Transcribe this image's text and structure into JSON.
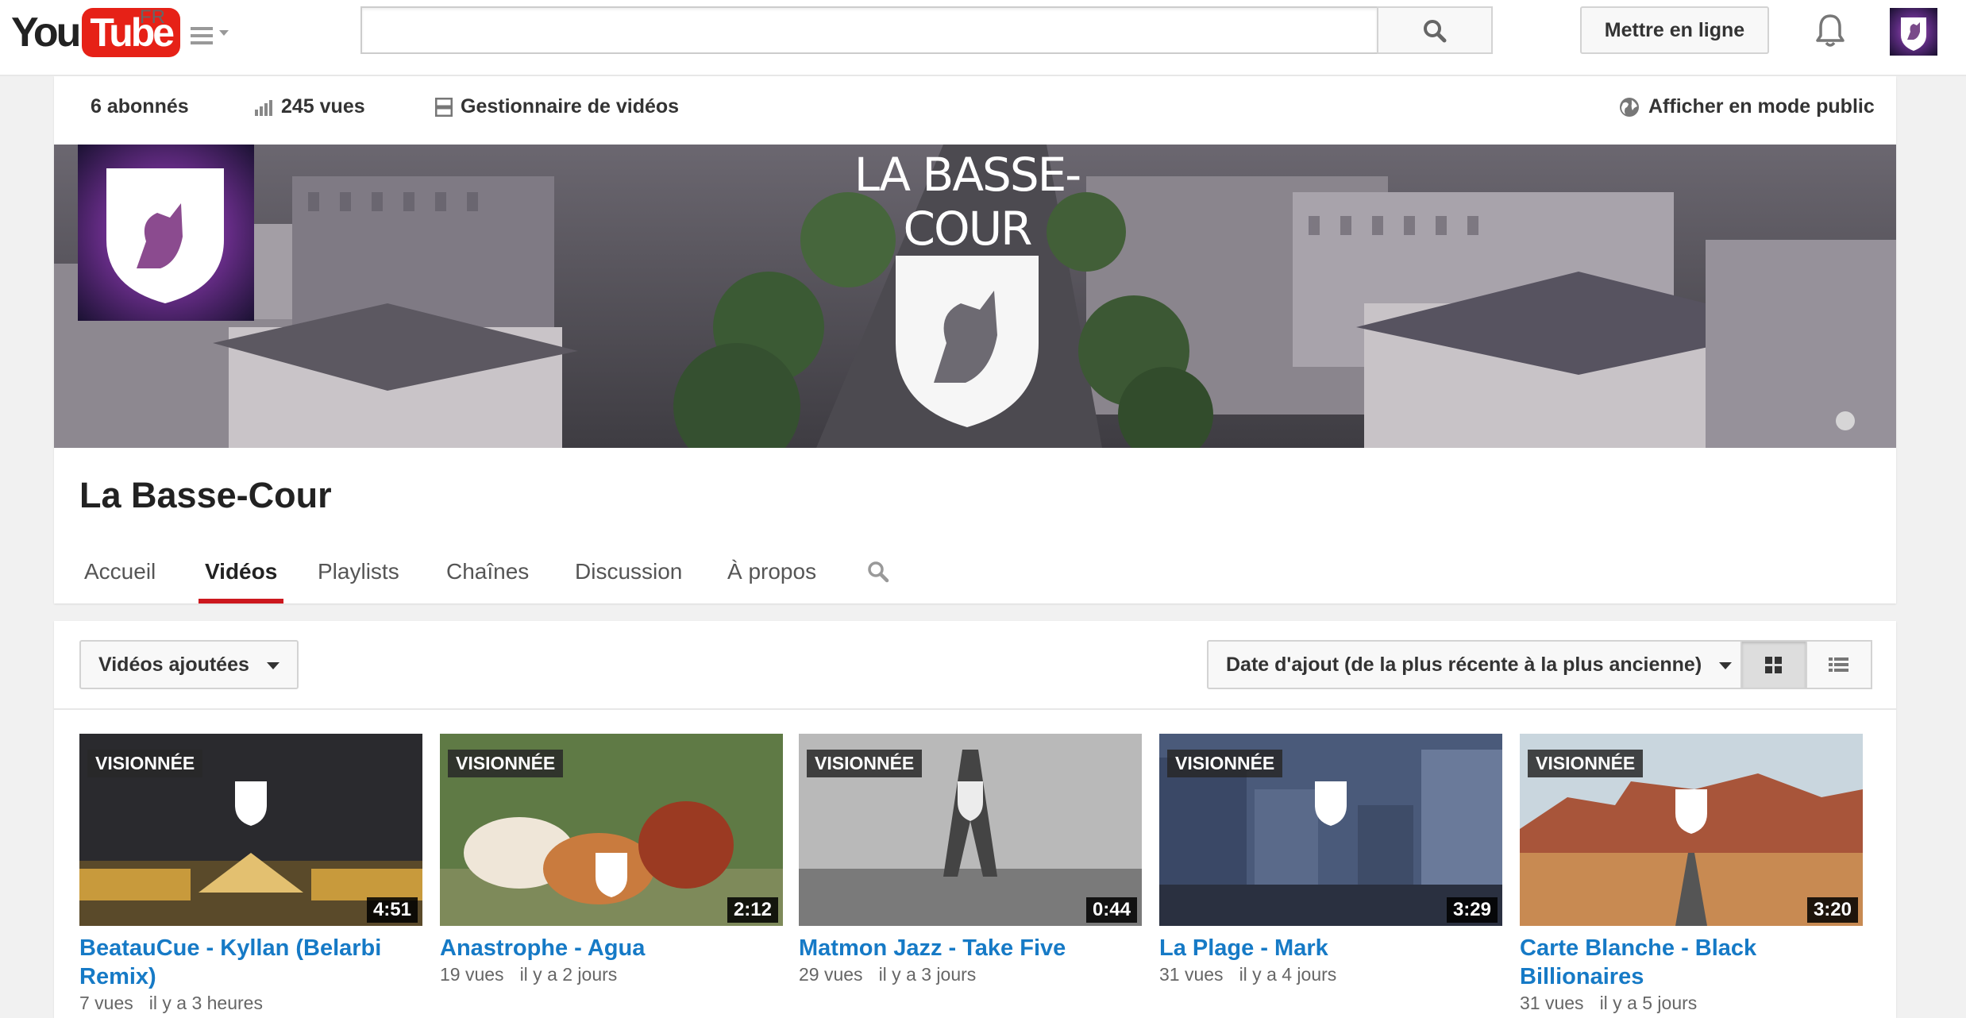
{
  "masthead": {
    "logo_you": "You",
    "logo_tube": "Tube",
    "region": "FR",
    "search_placeholder": "",
    "upload_label": "Mettre en ligne"
  },
  "stats": {
    "subscribers": "6 abonnés",
    "views": "245 vues",
    "video_manager": "Gestionnaire de vidéos",
    "public_view": "Afficher en mode public"
  },
  "banner": {
    "wordmark": "LA BASSE-COUR"
  },
  "channel": {
    "title": "La Basse-Cour"
  },
  "tabs": [
    {
      "label": "Accueil"
    },
    {
      "label": "Vidéos"
    },
    {
      "label": "Playlists"
    },
    {
      "label": "Chaînes"
    },
    {
      "label": "Discussion"
    },
    {
      "label": "À propos"
    }
  ],
  "filters": {
    "content_filter": "Vidéos ajoutées",
    "sort_filter": "Date d'ajout (de la plus récente à la plus ancienne)"
  },
  "videos": [
    {
      "watched": "VISIONNÉE",
      "duration": "4:51",
      "title": "BeatauCue - Kyllan (Belarbi Remix)",
      "views": "7 vues",
      "age": "il y a 3 heures"
    },
    {
      "watched": "VISIONNÉE",
      "duration": "2:12",
      "title": "Anastrophe - Agua",
      "views": "19 vues",
      "age": "il y a 2 jours"
    },
    {
      "watched": "VISIONNÉE",
      "duration": "0:44",
      "title": "Matmon Jazz - Take Five",
      "views": "29 vues",
      "age": "il y a 3 jours"
    },
    {
      "watched": "VISIONNÉE",
      "duration": "3:29",
      "title": "La Plage - Mark",
      "views": "31 vues",
      "age": "il y a 4 jours"
    },
    {
      "watched": "VISIONNÉE",
      "duration": "3:20",
      "title": "Carte Blanche - Black Billionaires",
      "views": "31 vues",
      "age": "il y a 5 jours"
    }
  ],
  "colors": {
    "brand_red": "#e62117",
    "link_blue": "#167ac6",
    "tab_underline": "#cc181e"
  }
}
